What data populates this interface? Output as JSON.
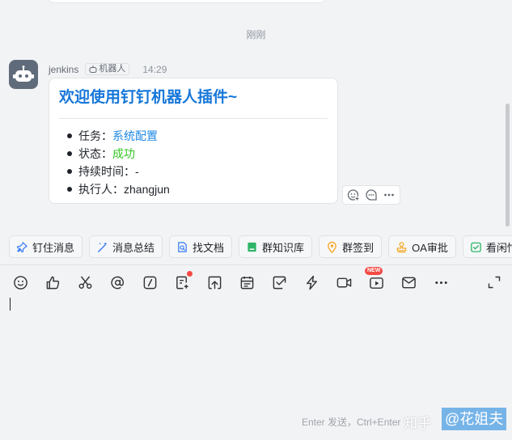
{
  "chat": {
    "time_divider": "刚刚",
    "message": {
      "sender": "jenkins",
      "robot_tag": "机器人",
      "time": "14:29",
      "card": {
        "title": "欢迎使用钉钉机器人插件~",
        "items": [
          {
            "label": "任务：",
            "value": "系统配置",
            "value_color": "#1e88e5"
          },
          {
            "label": "状态：",
            "value": "成功",
            "value_color": "#34c724"
          },
          {
            "label": "持续时间：",
            "value": "-"
          },
          {
            "label": "执行人：",
            "value": "zhangjun"
          }
        ]
      },
      "actions": [
        {
          "icon": "add-reaction-icon"
        },
        {
          "icon": "reply-icon"
        },
        {
          "icon": "more-icon"
        }
      ]
    }
  },
  "quick_actions": [
    {
      "label": "钉住消息",
      "icon": "pin-icon",
      "color": "#3478f6"
    },
    {
      "label": "消息总结",
      "icon": "magic-wand-icon",
      "color": "#3478f6"
    },
    {
      "label": "找文档",
      "icon": "doc-search-icon",
      "color": "#3478f6"
    },
    {
      "label": "群知识库",
      "icon": "knowledge-base-icon",
      "color": "#2fb567"
    },
    {
      "label": "群签到",
      "icon": "location-icon",
      "color": "#f5a623"
    },
    {
      "label": "OA审批",
      "icon": "stamp-icon",
      "color": "#f5a623"
    },
    {
      "label": "看闲忙",
      "icon": "calendar-check-icon",
      "color": "#2fb567"
    }
  ],
  "toolbar": {
    "icons": [
      "emoji-icon",
      "thumbs-up-icon",
      "scissors-icon",
      "at-icon",
      "slash-icon",
      "doc-add-icon",
      "upload-icon",
      "calendar-icon",
      "task-check-icon",
      "ding-icon",
      "video-call-icon",
      "live-icon",
      "mail-icon",
      "more-horizontal-icon"
    ],
    "new_badge": "NEW",
    "expand_icon": "expand-icon"
  },
  "input": {
    "hint": "Enter 发送，Ctrl+Enter"
  },
  "watermark": {
    "site": "知乎",
    "author": "@花姐夫"
  }
}
